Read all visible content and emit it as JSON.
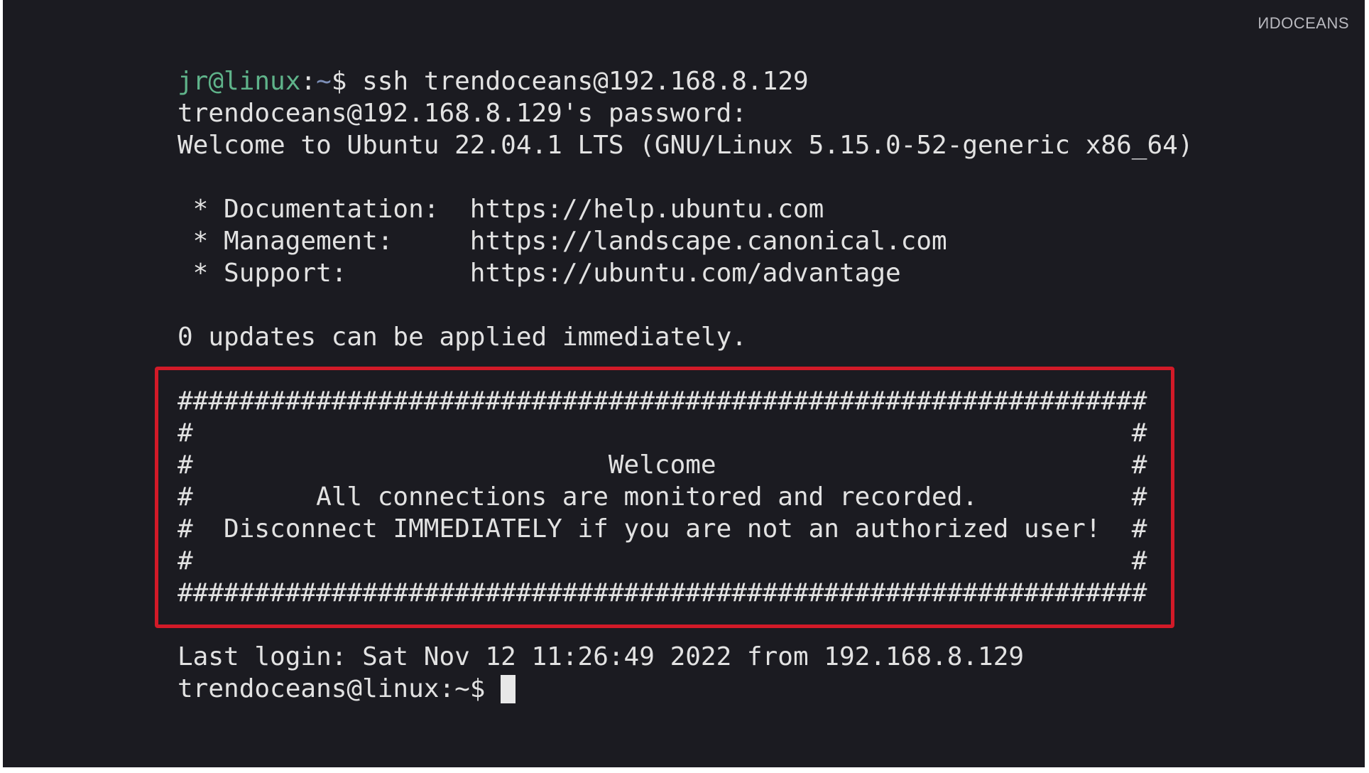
{
  "watermark": "ИDOCEANS",
  "session": {
    "prompt_user": "jr@linux",
    "prompt_sep": ":",
    "prompt_path": "~",
    "prompt_symbol": "$ ",
    "command": "ssh trendoceans@192.168.8.129",
    "password_prompt": "trendoceans@192.168.8.129's password:",
    "welcome_line": "Welcome to Ubuntu 22.04.1 LTS (GNU/Linux 5.15.0-52-generic x86_64)",
    "help_lines": [
      " * Documentation:  https://help.ubuntu.com",
      " * Management:     https://landscape.canonical.com",
      " * Support:        https://ubuntu.com/advantage"
    ],
    "updates_line": "0 updates can be applied immediately.",
    "banner_lines": [
      "###############################################################",
      "#                                                             #",
      "#                           Welcome                           #",
      "#        All connections are monitored and recorded.          #",
      "#  Disconnect IMMEDIATELY if you are not an authorized user!  #",
      "#                                                             #",
      "###############################################################"
    ],
    "last_login": "Last login: Sat Nov 12 11:26:49 2022 from 192.168.8.129",
    "final_prompt": "trendoceans@linux:~$ "
  }
}
